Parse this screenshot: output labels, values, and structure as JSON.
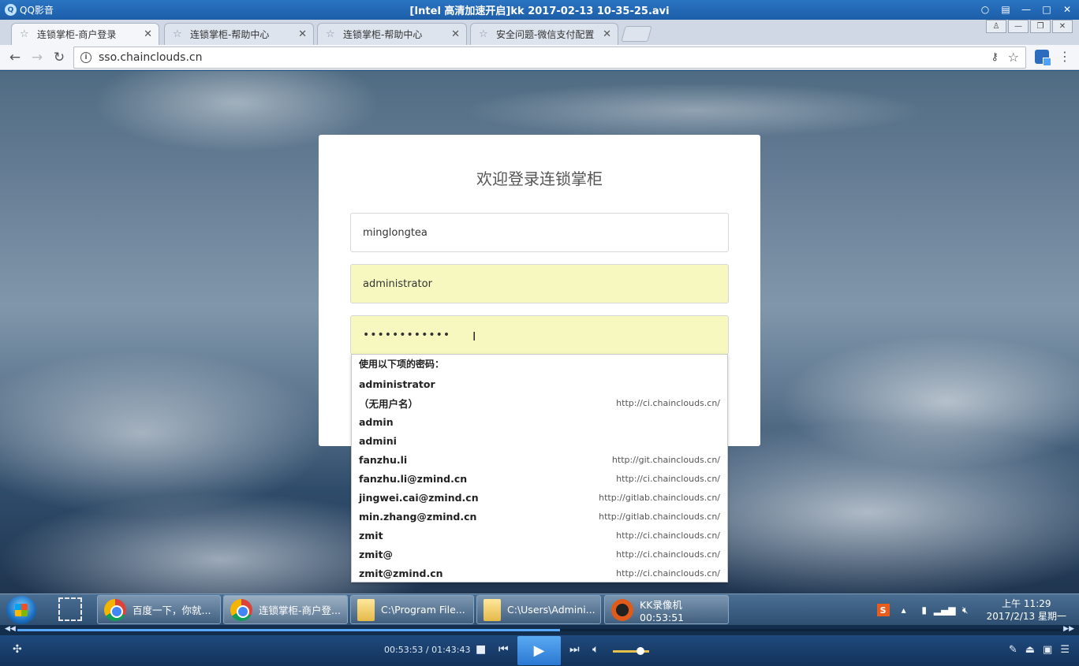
{
  "player": {
    "app_name": "QQ影音",
    "window_title": "[Intel 高清加速开启]kk 2017-02-13 10-35-25.avi",
    "time_current": "00:53:53",
    "time_total": "01:43:43",
    "time_label": "00:53:53 / 01:43:43",
    "progress_fraction": 0.52,
    "volume_fraction": 0.75
  },
  "browser": {
    "tabs": [
      {
        "title": "连锁掌柜-商户登录",
        "active": true
      },
      {
        "title": "连锁掌柜-帮助中心",
        "active": false
      },
      {
        "title": "连锁掌柜-帮助中心",
        "active": false
      },
      {
        "title": "安全问题-微信支付配置",
        "active": false
      }
    ],
    "url": "sso.chainclouds.cn"
  },
  "login": {
    "title": "欢迎登录连锁掌柜",
    "merchant_value": "minglongtea",
    "username_value": "administrator",
    "password_value": "••••••••••••"
  },
  "autocomplete": {
    "header": "使用以下项的密码：",
    "items": [
      {
        "user": "administrator",
        "site": ""
      },
      {
        "user": "（无用户名）",
        "site": "http://ci.chainclouds.cn/"
      },
      {
        "user": "admin",
        "site": ""
      },
      {
        "user": "admini",
        "site": ""
      },
      {
        "user": "fanzhu.li",
        "site": "http://git.chainclouds.cn/"
      },
      {
        "user": "fanzhu.li@zmind.cn",
        "site": "http://ci.chainclouds.cn/"
      },
      {
        "user": "jingwei.cai@zmind.cn",
        "site": "http://gitlab.chainclouds.cn/"
      },
      {
        "user": "min.zhang@zmind.cn",
        "site": "http://gitlab.chainclouds.cn/"
      },
      {
        "user": "zmit",
        "site": "http://ci.chainclouds.cn/"
      },
      {
        "user": "zmit@",
        "site": "http://ci.chainclouds.cn/"
      },
      {
        "user": "zmit@zmind.cn",
        "site": "http://ci.chainclouds.cn/"
      }
    ]
  },
  "taskbar": {
    "buttons": [
      {
        "label": "百度一下，你就...",
        "icon": "chrome-icon",
        "active": false
      },
      {
        "label": "连锁掌柜-商户登...",
        "icon": "chrome-icon",
        "active": true
      },
      {
        "label": "C:\\Program File...",
        "icon": "folder-icon",
        "active": false
      },
      {
        "label": "C:\\Users\\Admini...",
        "icon": "folder-icon",
        "active": false
      },
      {
        "label": "KK录像机 00:53:51",
        "icon": "kk-recorder-icon",
        "active": false
      }
    ],
    "clock_time": "上午 11:29",
    "clock_date": "2017/2/13 星期一"
  }
}
